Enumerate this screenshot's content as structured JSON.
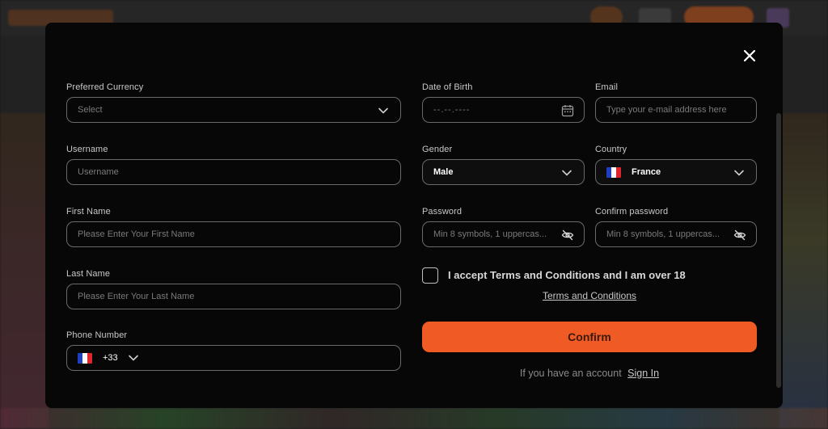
{
  "form": {
    "currency": {
      "label": "Preferred Currency",
      "placeholder": "Select"
    },
    "username": {
      "label": "Username",
      "placeholder": "Username"
    },
    "first_name": {
      "label": "First Name",
      "placeholder": "Please Enter Your First Name"
    },
    "last_name": {
      "label": "Last Name",
      "placeholder": "Please Enter Your Last Name"
    },
    "phone": {
      "label": "Phone Number",
      "code": "+33",
      "flag": "france-flag-icon"
    },
    "dob": {
      "label": "Date of Birth",
      "placeholder": "--.--.----"
    },
    "email": {
      "label": "Email",
      "placeholder": "Type your e-mail address here"
    },
    "gender": {
      "label": "Gender",
      "value": "Male"
    },
    "country": {
      "label": "Country",
      "value": "France",
      "flag": "france-flag-icon"
    },
    "password": {
      "label": "Password",
      "placeholder": "Min 8 symbols, 1 uppercas..."
    },
    "confirm_password": {
      "label": "Confirm password",
      "placeholder": "Min 8 symbols, 1 uppercas..."
    },
    "accept_text": "I accept Terms and Conditions and I am over 18",
    "terms_link": "Terms and Conditions",
    "confirm_label": "Confirm",
    "have_account": "If you have an account",
    "sign_in": "Sign In"
  },
  "icons": {
    "close": "close-icon",
    "chevron": "chevron-down-icon",
    "calendar": "calendar-icon",
    "eye_off": "eye-off-icon"
  },
  "colors": {
    "accent": "#f05a24",
    "modal_bg": "#070707",
    "border": "#6a6a6a"
  }
}
